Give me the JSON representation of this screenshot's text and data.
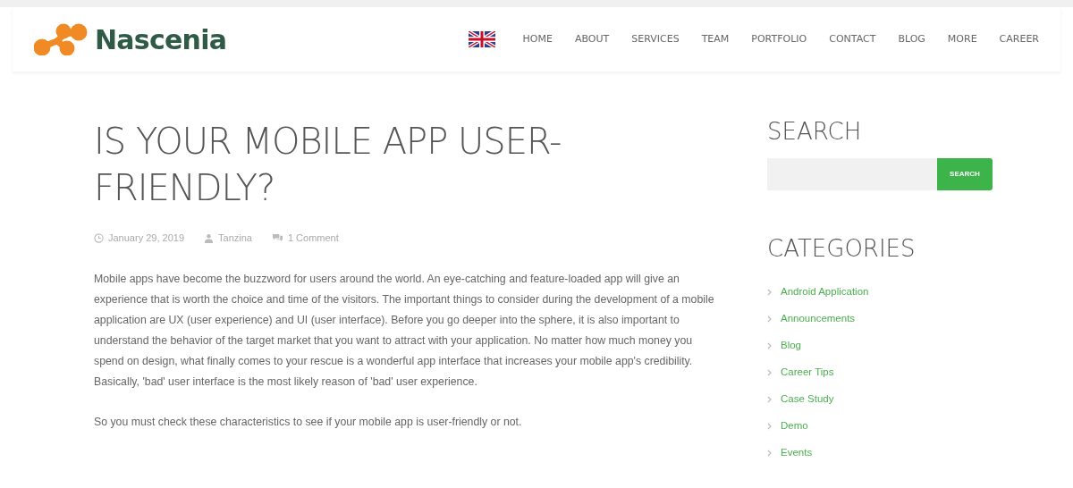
{
  "header": {
    "logo_text": "Nascenia",
    "nav": [
      {
        "label": "HOME"
      },
      {
        "label": "ABOUT"
      },
      {
        "label": "SERVICES"
      },
      {
        "label": "TEAM"
      },
      {
        "label": "PORTFOLIO"
      },
      {
        "label": "CONTACT"
      },
      {
        "label": "BLOG"
      },
      {
        "label": "MORE"
      },
      {
        "label": "CAREER"
      }
    ]
  },
  "post": {
    "title": "IS YOUR MOBILE APP USER-FRIENDLY?",
    "meta": [
      {
        "kind": "date",
        "text": "January 29, 2019"
      },
      {
        "kind": "author",
        "text": "Tanzina"
      },
      {
        "kind": "comments",
        "text": "1 Comment"
      }
    ],
    "paragraphs": [
      "Mobile apps have become the buzzword for users around the world. An eye-catching and feature-loaded app will give an experience that is worth the choice and time of the visitors. The important things to consider during the development of a mobile application are UX (user experience) and UI (user interface). Before you go deeper into the sphere, it is also important to understand the behavior of the target market that you want to attract with your application. No matter how much money you spend on design, what finally comes to your rescue is a wonderful app interface that increases your mobile app's credibility. Basically, 'bad' user interface is the most likely reason of 'bad' user experience.",
      "So you must check these characteristics to see if your mobile app is user-friendly or not."
    ]
  },
  "sidebar": {
    "search_heading": "SEARCH",
    "search_button": "SEARCH",
    "categories_heading": "CATEGORIES",
    "categories": [
      {
        "label": "Android Application"
      },
      {
        "label": "Announcements"
      },
      {
        "label": "Blog"
      },
      {
        "label": "Career Tips"
      },
      {
        "label": "Case Study"
      },
      {
        "label": "Demo"
      },
      {
        "label": "Events"
      }
    ]
  }
}
